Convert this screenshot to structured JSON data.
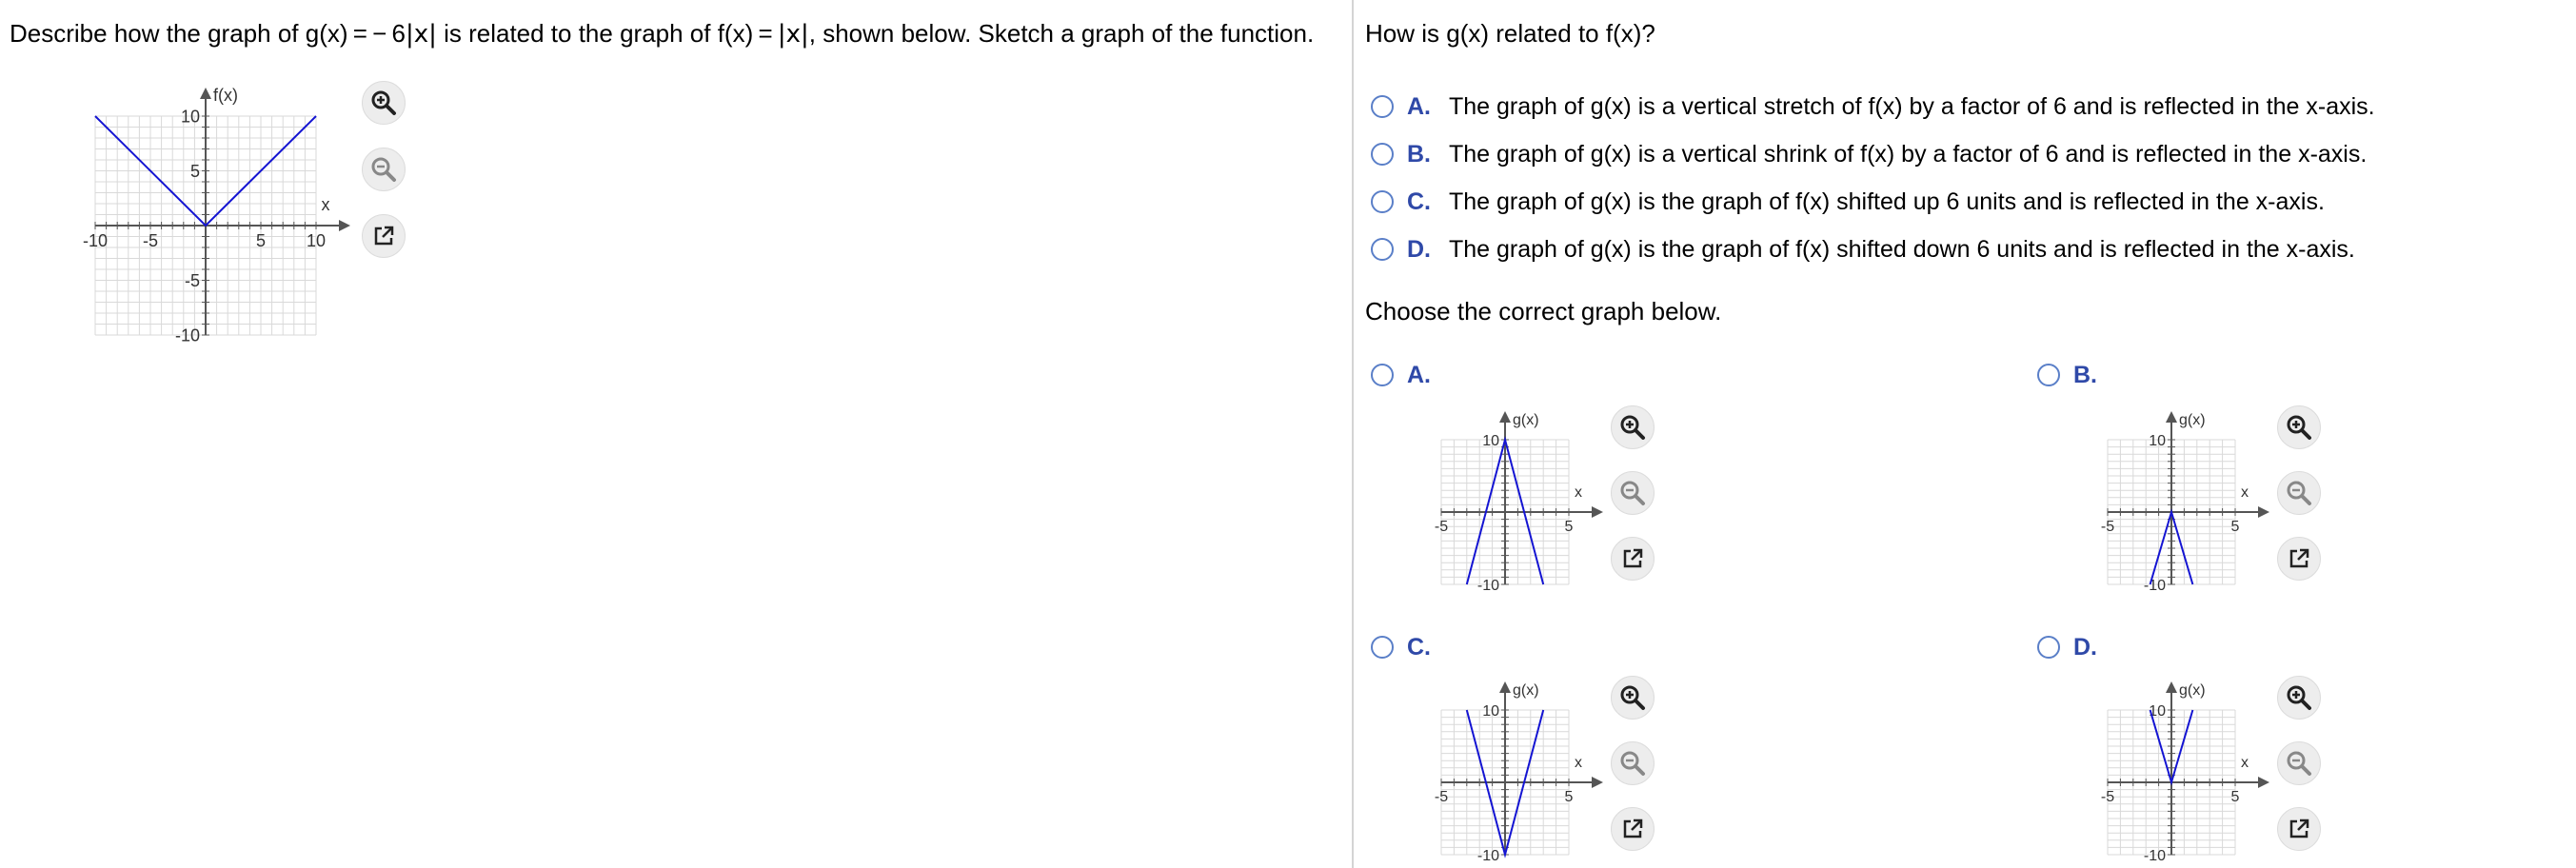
{
  "left": {
    "question_parts": [
      "Describe how the graph of g(x) = − 6",
      "|x|",
      " is related to the graph of f(x) = ",
      "|x|",
      ", shown below. Sketch a graph of the function."
    ],
    "graph": {
      "ylabel": "f(x)",
      "xlabel": "x",
      "xticks": [
        "-10",
        "-5",
        "5",
        "10"
      ],
      "yticks": [
        "10",
        "5",
        "-5",
        "-10"
      ]
    }
  },
  "right": {
    "question": "How is g(x) related to f(x)?",
    "options": [
      {
        "letter": "A.",
        "text": "The graph of g(x) is a vertical stretch of f(x) by a factor of 6 and is reflected in the x-axis."
      },
      {
        "letter": "B.",
        "text": "The graph of g(x) is a vertical shrink of f(x) by a factor of 6 and is reflected in the x-axis."
      },
      {
        "letter": "C.",
        "text": "The graph of g(x) is the graph of f(x) shifted up 6 units and is reflected in the x-axis."
      },
      {
        "letter": "D.",
        "text": "The graph of g(x) is the graph of f(x) shifted down 6 units and is reflected in the x-axis."
      }
    ],
    "choose": "Choose the correct graph below.",
    "graph_options": [
      {
        "letter": "A.",
        "ylabel": "g(x)",
        "xlabel": "x",
        "xticks": [
          "-5",
          "5"
        ],
        "yticks": [
          "10",
          "-10"
        ]
      },
      {
        "letter": "B.",
        "ylabel": "g(x)",
        "xlabel": "x",
        "xticks": [
          "-5",
          "5"
        ],
        "yticks": [
          "10",
          "-10"
        ]
      },
      {
        "letter": "C.",
        "ylabel": "g(x)",
        "xlabel": "x",
        "xticks": [
          "-5",
          "5"
        ],
        "yticks": [
          "10",
          "-10"
        ]
      },
      {
        "letter": "D.",
        "ylabel": "g(x)",
        "xlabel": "x",
        "xticks": [
          "-5",
          "5"
        ],
        "yticks": [
          "10",
          "-10"
        ]
      }
    ]
  },
  "chart_data": [
    {
      "type": "line",
      "name": "f(x)=|x|",
      "xlim": [
        -10,
        10
      ],
      "ylim": [
        -10,
        10
      ],
      "grid": true,
      "points": [
        [
          -10,
          10
        ],
        [
          0,
          0
        ],
        [
          10,
          10
        ]
      ]
    },
    {
      "type": "line",
      "name": "option-A",
      "xlim": [
        -5,
        5
      ],
      "ylim": [
        -10,
        10
      ],
      "grid": true,
      "points": [
        [
          -3,
          -10
        ],
        [
          0,
          10
        ],
        [
          3,
          -10
        ]
      ]
    },
    {
      "type": "line",
      "name": "option-B",
      "xlim": [
        -5,
        5
      ],
      "ylim": [
        -10,
        10
      ],
      "grid": true,
      "points": [
        [
          -1.67,
          -10
        ],
        [
          0,
          0
        ],
        [
          1.67,
          -10
        ]
      ]
    },
    {
      "type": "line",
      "name": "option-C",
      "xlim": [
        -5,
        5
      ],
      "ylim": [
        -10,
        10
      ],
      "grid": true,
      "points": [
        [
          -3,
          10
        ],
        [
          0,
          -10
        ],
        [
          3,
          10
        ]
      ]
    },
    {
      "type": "line",
      "name": "option-D",
      "xlim": [
        -5,
        5
      ],
      "ylim": [
        -10,
        10
      ],
      "grid": true,
      "points": [
        [
          -1.67,
          10
        ],
        [
          0,
          0
        ],
        [
          1.67,
          10
        ]
      ]
    }
  ],
  "colors": {
    "curve": "#1414d2",
    "grid": "#d9d9d9",
    "axis": "#555555",
    "radio": "#5a7fc8",
    "letter": "#2f49a8"
  },
  "tool_icons": [
    "zoom-in-icon",
    "zoom-out-icon",
    "pop-out-icon"
  ]
}
